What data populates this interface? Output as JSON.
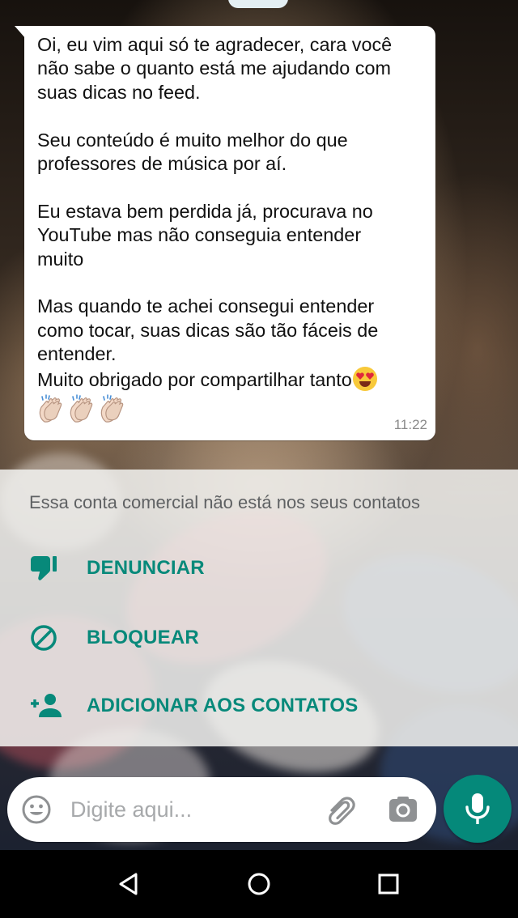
{
  "message": {
    "text": "Oi, eu vim aqui só te agradecer, cara você\nnão sabe o quanto está me ajudando com\nsuas dicas no feed.\n\nSeu conteúdo é muito melhor do que\nprofessores de música por aí.\n\nEu estava bem perdida já, procurava no\nYouTube mas não conseguia entender\nmuito\n\nMas quando te achei consegui entender\ncomo tocar, suas dicas são tão fáceis de\nentender.\nMuito obrigado por compartilhar tanto",
    "emoji_inline": "smiling-face-with-heart-eyes",
    "emoji_row": [
      "clapping-hands",
      "clapping-hands",
      "clapping-hands"
    ],
    "time": "11:22",
    "bubble_color": "#ffffff"
  },
  "notice": {
    "text": "Essa conta comercial não está nos seus contatos",
    "actions": [
      {
        "label": "DENUNCIAR",
        "icon": "thumbs-down-icon"
      },
      {
        "label": "BLOQUEAR",
        "icon": "block-icon"
      },
      {
        "label": "ADICIONAR AOS CONTATOS",
        "icon": "add-contact-icon"
      }
    ],
    "accent_color": "#07897a"
  },
  "composer": {
    "placeholder": "Digite aqui...",
    "icons": [
      "emoji-icon",
      "paperclip-icon",
      "camera-icon"
    ],
    "send_icon": "mic-icon",
    "send_color": "#05897a"
  },
  "navbar": {
    "buttons": [
      "back-icon",
      "home-icon",
      "recents-icon"
    ]
  }
}
